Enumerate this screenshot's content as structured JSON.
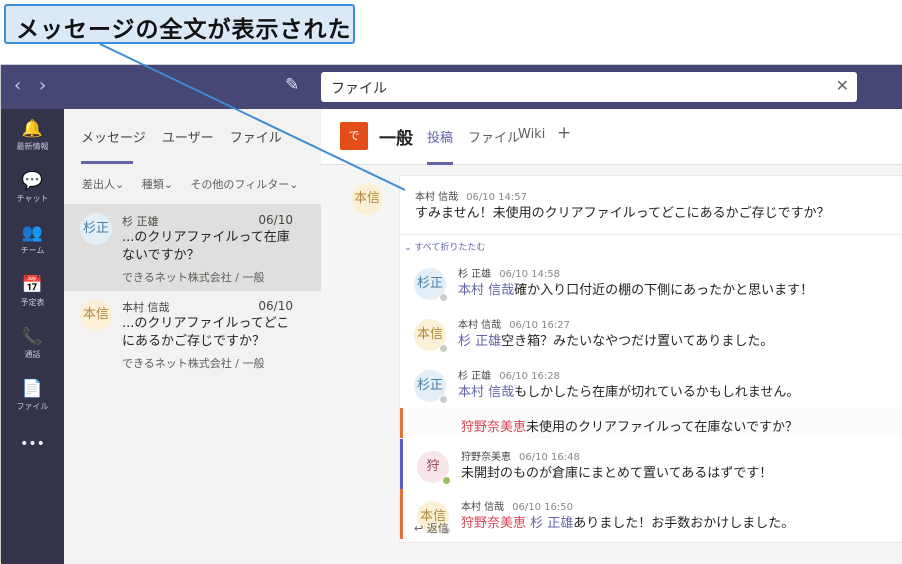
{
  "callout": "メッセージの全文が表示された",
  "topbar": {
    "back_icon": "chevron-left-icon",
    "forward_icon": "chevron-right-icon",
    "compose_icon": "compose-icon",
    "search_value": "ファイル",
    "clear_icon": "close-icon"
  },
  "rail": [
    {
      "label": "最新情報",
      "icon": "bell-icon",
      "glyph": "🔔"
    },
    {
      "label": "チャット",
      "icon": "chat-icon",
      "glyph": "💬"
    },
    {
      "label": "チーム",
      "icon": "teams-icon",
      "glyph": "👥"
    },
    {
      "label": "予定表",
      "icon": "calendar-icon",
      "glyph": "📅"
    },
    {
      "label": "通話",
      "icon": "phone-icon",
      "glyph": "📞"
    },
    {
      "label": "ファイル",
      "icon": "file-icon",
      "glyph": "📄"
    },
    {
      "label": "",
      "icon": "more-icon",
      "glyph": "•••"
    }
  ],
  "search_tabs": [
    "メッセージ",
    "ユーザー",
    "ファイル"
  ],
  "filters": [
    "差出人⌄",
    "種類⌄",
    "その他のフィルター⌄"
  ],
  "results": [
    {
      "avatar": "杉正",
      "name": "杉 正雄",
      "date": "06/10",
      "text": "...のクリアファイルって在庫ないですか？",
      "meta": "できるネット株式会社 / 一般"
    },
    {
      "avatar": "本信",
      "name": "本村 信哉",
      "date": "06/10",
      "text": "...のクリアファイルってどこにあるかご存じですか？",
      "meta": "できるネット株式会社 / 一般"
    }
  ],
  "channel": {
    "team_icon": "で",
    "name": "一般",
    "tabs": [
      "投稿",
      "ファイル",
      "Wiki",
      "+"
    ]
  },
  "post": {
    "avatar": "本信",
    "author": "本村 信哉",
    "time": "06/10 14:57",
    "body": "すみません！未使用のクリアファイルってどこにあるかご存じですか？",
    "collapse": "⌄ すべて折りたたむ"
  },
  "replies": [
    {
      "avatar": "杉正",
      "author": "杉 正雄",
      "time": "06/10 14:58",
      "mention": "本村 信哉",
      "text": "確か入り口付近の棚の下側にあったかと思います！"
    },
    {
      "avatar": "本信",
      "author": "本村 信哉",
      "time": "06/10 16:27",
      "mention": "杉 正雄",
      "text": "空き箱？みたいなやつだけ置いてありました。"
    },
    {
      "avatar": "杉正",
      "author": "杉 正雄",
      "time": "06/10 16:28",
      "mention": "本村 信哉",
      "text": "もしかしたら在庫が切れているかもしれません。"
    },
    {
      "avatar": "",
      "author": "",
      "time": "",
      "mention": "狩野奈美恵",
      "text": "未使用のクリアファイルって在庫ないですか？"
    },
    {
      "avatar": "狩",
      "author": "狩野奈美恵",
      "time": "06/10 16:48",
      "mention": "",
      "text": "未開封のものが倉庫にまとめて置いてあるはずです！"
    },
    {
      "avatar": "本信",
      "author": "本村 信哉",
      "time": "06/10 16:50",
      "mention": "狩野奈美恵",
      "mention2": "杉 正雄",
      "text": "ありました！お手数おかけしました。"
    }
  ],
  "reply_link": "↩ 返信"
}
